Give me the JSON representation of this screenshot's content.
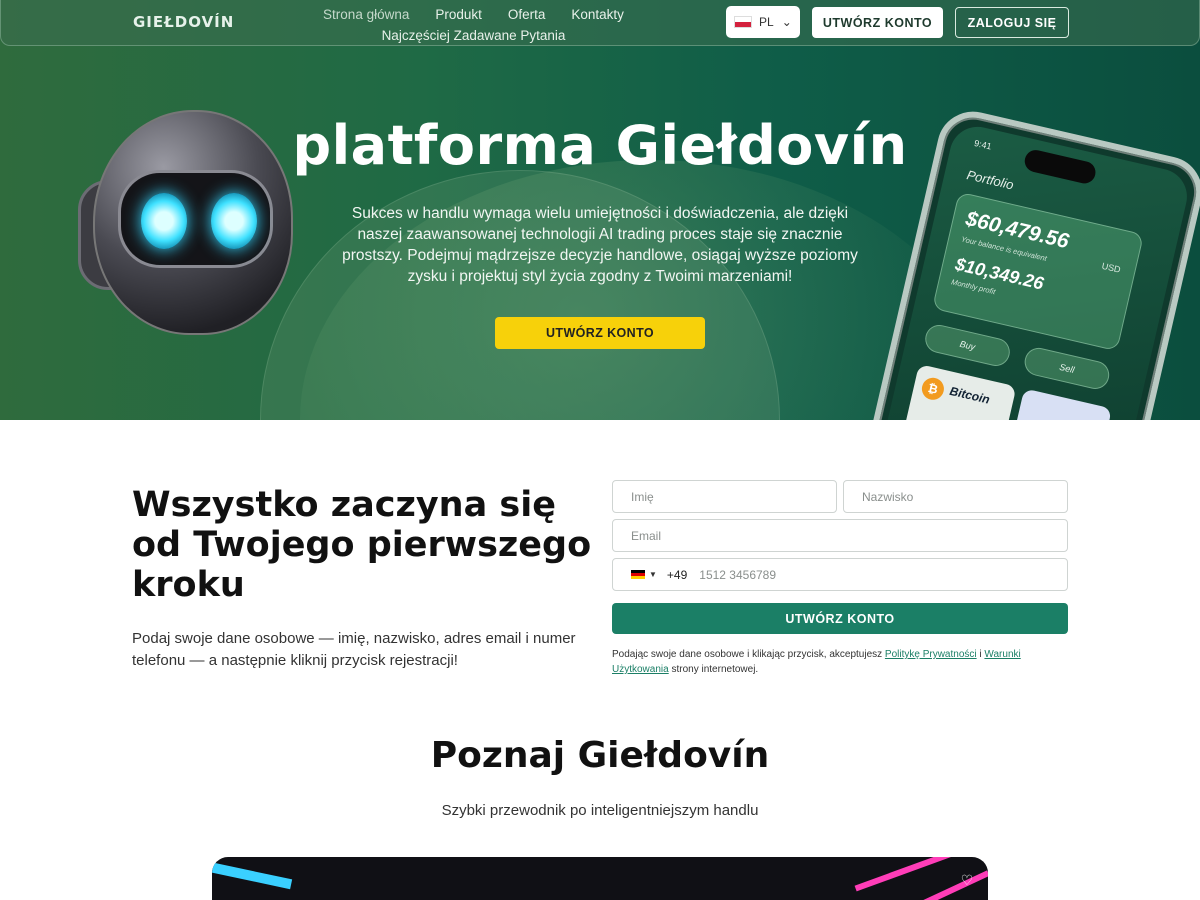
{
  "header": {
    "logo": "GIEŁDOVÍN",
    "nav": [
      "Strona główna",
      "Produkt",
      "Oferta",
      "Kontakty",
      "Najczęściej Zadawane Pytania"
    ],
    "lang": "PL",
    "create_account": "UTWÓRZ KONTO",
    "login": "ZALOGUJ SIĘ"
  },
  "hero": {
    "title": "platforma Giełdovín",
    "description": "Sukces w handlu wymaga wielu umiejętności i doświadczenia, ale dzięki naszej zaawansowanej technologii AI trading proces staje się znacznie prostszy. Podejmuj mądrzejsze decyzje handlowe, osiągaj wyższe poziomy zysku i projektuj styl życia zgodny z Twoimi marzeniami!",
    "cta": "UTWÓRZ KONTO"
  },
  "phone": {
    "time": "9:41",
    "portfolio": "Portfolio",
    "balance": "$60,479.56",
    "balance_sub": "Your balance is equivalent",
    "currency": "USD",
    "profit": "$10,349.26",
    "profit_sub": "Monthly profit",
    "buy": "Buy",
    "sell": "Sell",
    "coin": "Bitcoin"
  },
  "registration": {
    "title": "Wszystko zaczyna się od Twojego pierwszego kroku",
    "description": "Podaj swoje dane osobowe — imię, nazwisko, adres email i numer telefonu — a następnie kliknij przycisk rejestracji!",
    "first_name_placeholder": "Imię",
    "last_name_placeholder": "Nazwisko",
    "email_placeholder": "Email",
    "phone_code": "+49",
    "phone_placeholder": "1512 3456789",
    "submit": "UTWÓRZ KONTO",
    "terms_prefix": "Podając swoje dane osobowe i klikając przycisk, akceptujesz",
    "privacy_link": "Politykę Prywatności",
    "and": "i",
    "terms_link": "Warunki Użytkowania",
    "terms_suffix": "strony internetowej."
  },
  "meet": {
    "title": "Poznaj Giełdovín",
    "subtitle": "Szybki przewodnik po inteligentniejszym handlu"
  },
  "colors": {
    "hero_green": "#1f6a45",
    "accent_yellow": "#f7d10a",
    "button_teal": "#1b7f66"
  }
}
